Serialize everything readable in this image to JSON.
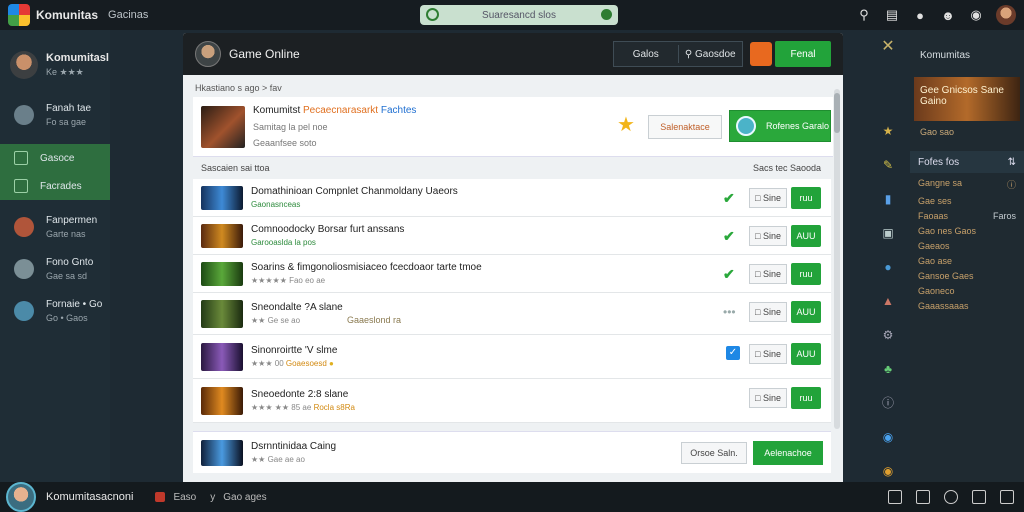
{
  "topbar": {
    "brand": "Komunitas",
    "nav": "Gacinas",
    "search_text": "Suaresancd slos"
  },
  "left": {
    "profile_name": "Komumitasl",
    "profile_sub": "Ke ★★★",
    "items": [
      {
        "label": "Fanah tae",
        "sub": "Fo sa gae"
      },
      {
        "label": "Gasoce",
        "sub": ""
      },
      {
        "label": "Facrades",
        "sub": ""
      },
      {
        "label": "Fanpermen",
        "sub": "Garte nas"
      },
      {
        "label": "Fono Gnto",
        "sub": "Gae sa sd"
      },
      {
        "label": "Fornaie • Go",
        "sub": "Go • Gaos"
      }
    ]
  },
  "modal": {
    "title": "Game Online",
    "tabs": [
      "Galos",
      "Gaosdoe"
    ],
    "primary_button": "Fenal",
    "breadcrumb": "Hkastiano s ago > fav",
    "featured": {
      "title_a": "Komumitst",
      "title_b": "Pecaecnarasarkt",
      "title_c": "Fachtes",
      "sub1": "Samitag la pel noe",
      "sub2": "Geaanfsee soto",
      "button": "Salenaktace",
      "green_label": "Rofenes Garalo"
    },
    "list_header_left": "Sascaien sai ttoa",
    "list_header_right": "Sacs tec Saooda",
    "rows": [
      {
        "title": "Domathinioan Compnlet Chanmoldany Uaeors",
        "sub": "Gaonasnceas",
        "mid": "",
        "status": "check",
        "btn": "Sine",
        "go": "ruu"
      },
      {
        "title": "Comnoodocky Borsar furt anssans",
        "sub": "Garooaslda la pos",
        "mid": "",
        "status": "check",
        "btn": "Sine",
        "go": "AUU"
      },
      {
        "title": "Soarins & fimgonoliosmisiaceo fcecdoaor tarte tmoe",
        "sub": "★★★★★ Fao eo ae",
        "mid": "",
        "status": "check",
        "btn": "Sine",
        "go": "ruu"
      },
      {
        "title": "Sneondalte ?A slane",
        "sub": "★★ Ge se ao",
        "mid": "Gaaeslond ra",
        "status": "dots",
        "btn": "Sine",
        "go": "AUU"
      },
      {
        "title": "Sinonroirtte 'V slme",
        "sub": "★★★ 00",
        "mid": "Goaesoesd",
        "status": "box",
        "btn": "Sine",
        "go": "AUU"
      },
      {
        "title": "Sneoedonte 2:8 slane",
        "sub": "★★★ ★★ 85 ae",
        "mid": "Rocla s8Ra",
        "status": "",
        "btn": "Sine",
        "go": "ruu"
      }
    ],
    "footer": {
      "title": "Dsrnntinidaa Caing",
      "sub": "★★ Gae ae ao",
      "btn": "Orsoe Saln.",
      "primary": "Aelenachoe"
    }
  },
  "right": {
    "title": "Komumitas",
    "banner": "Gee Gnicsos Sane Gaino",
    "small": "Gao sao",
    "section": "Fofes fos",
    "rows": [
      {
        "a": "Gangne sa",
        "b": ""
      },
      {
        "a": "Gae ses",
        "b": ""
      },
      {
        "a": "Faoaas",
        "b": "Faros"
      },
      {
        "a": "Gao nes Gaos",
        "b": ""
      },
      {
        "a": "Gaeaos",
        "b": ""
      },
      {
        "a": "Gao ase",
        "b": ""
      },
      {
        "a": "Gansoe Gaes",
        "b": ""
      },
      {
        "a": "Gaoneco",
        "b": ""
      },
      {
        "a": "Gaaassaaas",
        "b": ""
      }
    ]
  },
  "bottombar": {
    "name": "Komumitasacnoni",
    "status": "Easo",
    "count": "y",
    "extra": "Gao ages"
  }
}
